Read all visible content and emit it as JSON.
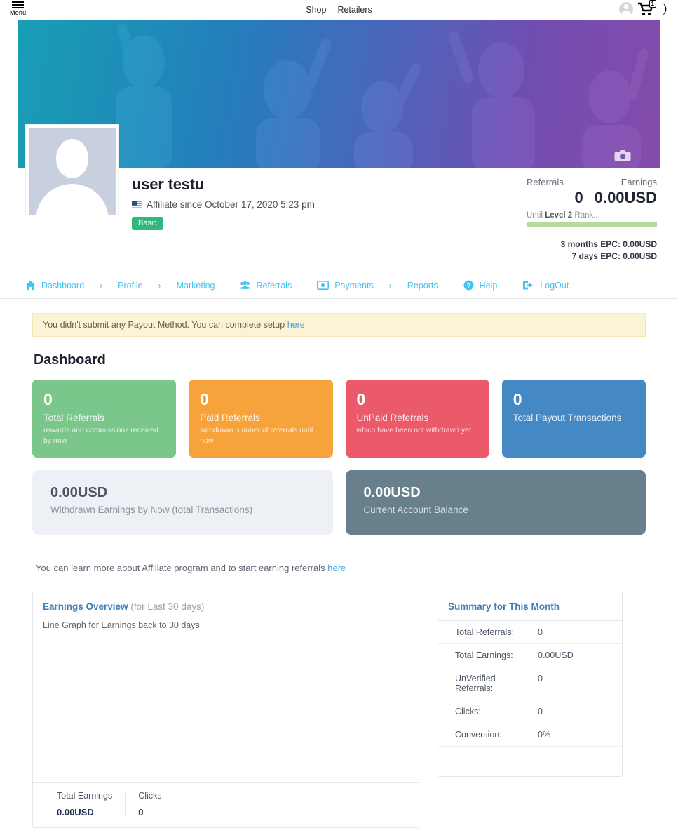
{
  "topbar": {
    "menu_label": "Menu",
    "menu_icon": "hamburger-icon",
    "nav": [
      {
        "label": "Shop"
      },
      {
        "label": "Retailers"
      }
    ],
    "account_icon": "user-avatar-icon",
    "cart_icon": "shopping-cart-icon",
    "cart_count": "1",
    "darkmode_icon": "moon-icon"
  },
  "cover": {
    "camera_icon": "camera-icon",
    "gradient_from": "#17a9bf",
    "gradient_to": "#8e4fb5"
  },
  "profile": {
    "avatar_icon": "user-placeholder-avatar",
    "name": "user testu",
    "flag_icon": "us-flag-icon",
    "since": "Affiliate since October 17, 2020 5:23 pm",
    "badge": "Basic",
    "badge_color": "#31b97a",
    "stats": {
      "referrals_label": "Referrals",
      "earnings_label": "Earnings",
      "referrals_value": "0",
      "earnings_value": "0.00USD",
      "until_prefix": "Until ",
      "until_level": "Level 2",
      "until_suffix": " Rank...",
      "progress_color": "#b8d9a0",
      "epc_3months": "3 months EPC: 0.00USD",
      "epc_7days": "7 days EPC: 0.00USD"
    }
  },
  "nav": {
    "accent": "#46c3f0",
    "items": [
      {
        "label": "Dashboard",
        "icon": "home-icon"
      },
      {
        "label": "Profile",
        "icon": ""
      },
      {
        "label": "Marketing",
        "icon": ""
      },
      {
        "label": "Referrals",
        "icon": "users-icon"
      },
      {
        "label": "Payments",
        "icon": "money-bill-icon"
      },
      {
        "label": "Reports",
        "icon": ""
      },
      {
        "label": "Help",
        "icon": "question-circle-icon"
      },
      {
        "label": "LogOut",
        "icon": "sign-out-icon"
      }
    ],
    "separator": "›"
  },
  "alert": {
    "text": "You didn't submit any Payout Method. You can complete setup ",
    "link": "here",
    "bg": "#fcf3d7"
  },
  "page_title": "Dashboard",
  "stat_cards": [
    {
      "value": "0",
      "label": "Total Referrals",
      "sub": "rewards and commissions received by now",
      "color": "#7ac68b"
    },
    {
      "value": "0",
      "label": "Paid Referrals",
      "sub": "withdrawn number of referrals until now",
      "color": "#f7a33c"
    },
    {
      "value": "0",
      "label": "UnPaid Referrals",
      "sub": "which have been not withdrawn yet",
      "color": "#eb5a6a"
    },
    {
      "value": "0",
      "label": "Total Payout Transactions",
      "sub": "",
      "color": "#4488c4"
    }
  ],
  "wide_cards": [
    {
      "value": "0.00USD",
      "label": "Withdrawn Earnings by Now (total Transactions)",
      "theme": "light"
    },
    {
      "value": "0.00USD",
      "label": "Current Account Balance",
      "theme": "dark"
    }
  ],
  "learn_more": {
    "text": "You can learn more about Affiliate program and to start earning referrals ",
    "link": "here"
  },
  "earnings_panel": {
    "title": "Earnings Overview",
    "subtitle": "(for Last 30 days)",
    "note": "Line Graph for Earnings back to 30 days.",
    "footer": [
      {
        "key": "Total Earnings",
        "value": "0.00USD"
      },
      {
        "key": "Clicks",
        "value": "0"
      }
    ]
  },
  "summary_panel": {
    "title": "Summary for This Month",
    "rows": [
      {
        "key": "Total Referrals:",
        "value": "0"
      },
      {
        "key": "Total Earnings:",
        "value": "0.00USD"
      },
      {
        "key": "UnVerified Referrals:",
        "value": "0"
      },
      {
        "key": "Clicks:",
        "value": "0"
      },
      {
        "key": "Conversion:",
        "value": "0%"
      }
    ]
  },
  "chart_data": {
    "type": "line",
    "title": "Earnings Overview",
    "subtitle": "(for Last 30 days)",
    "xlabel": "",
    "ylabel": "",
    "series": [
      {
        "name": "Earnings",
        "values": []
      }
    ],
    "x": [],
    "grid": false,
    "legend": "none",
    "note": "Line Graph for Earnings back to 30 days.",
    "empty": true
  }
}
